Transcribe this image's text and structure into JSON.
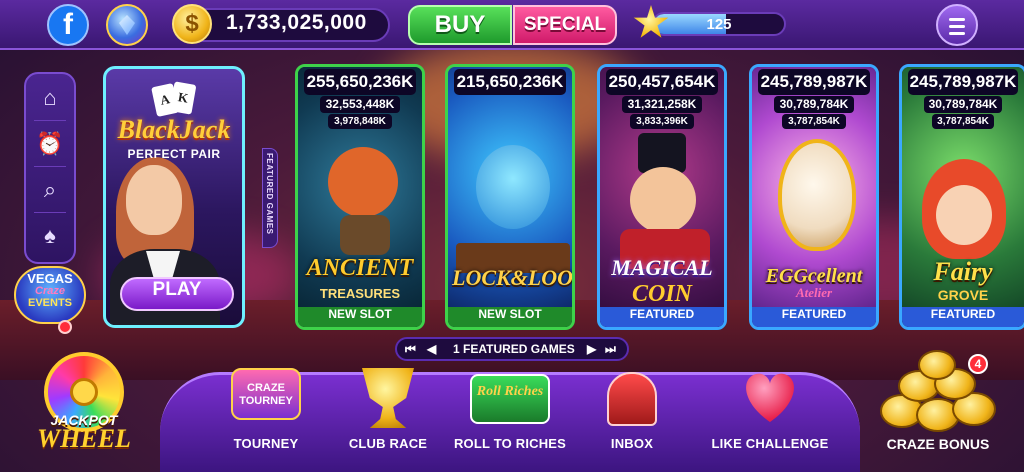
{
  "topbar": {
    "coins": "1,733,025,000",
    "buy_label": "BUY",
    "special_label": "SPECIAL",
    "level_progress_value": "125",
    "level_progress_fraction": 0.55,
    "facebook_glyph": "f",
    "coin_glyph": "$"
  },
  "left_rail": {
    "items": [
      {
        "icon": "home-icon",
        "glyph": "⌂"
      },
      {
        "icon": "alarm-clock-icon",
        "glyph": "⏰"
      },
      {
        "icon": "search-icon",
        "glyph": "⌕"
      },
      {
        "icon": "cards-icon",
        "glyph": "♠"
      }
    ],
    "events": {
      "line1": "VEGAS",
      "line2": "Craze",
      "line3": "EVENTS"
    }
  },
  "blackjack": {
    "title": "BlackJack",
    "subtitle": "PERFECT PAIR",
    "play_label": "PLAY",
    "card1": "A",
    "card2": "K"
  },
  "featured_tab": "FEATURED GAMES",
  "slots": [
    {
      "jackpot_major": "255,650,236K",
      "jackpot_minor": "32,553,448K",
      "jackpot_mini": "3,978,848K",
      "logo": "ANCIENT",
      "logo_sub": "TREASURES",
      "tag": "NEW SLOT",
      "tag_color": "#1f8a2a"
    },
    {
      "jackpot_major": "215,650,236K",
      "jackpot_minor": "",
      "jackpot_mini": "",
      "logo": "LOCK&LOOT",
      "logo_sub": "",
      "tag": "NEW SLOT",
      "tag_color": "#1f8a2a"
    },
    {
      "jackpot_major": "250,457,654K",
      "jackpot_minor": "31,321,258K",
      "jackpot_mini": "3,833,396K",
      "logo": "MAGICAL",
      "logo_sub": "COIN",
      "tag": "FEATURED",
      "tag_color": "#2a5ad8"
    },
    {
      "jackpot_major": "245,789,987K",
      "jackpot_minor": "30,789,784K",
      "jackpot_mini": "3,787,854K",
      "logo": "EGGcellent",
      "logo_sub": "Atelier",
      "tag": "FEATURED",
      "tag_color": "#2a5ad8"
    },
    {
      "jackpot_major": "245,789,987K",
      "jackpot_minor": "30,789,784K",
      "jackpot_mini": "3,787,854K",
      "logo": "Fairy",
      "logo_sub": "GROVE",
      "tag": "FEATURED",
      "tag_color": "#2a5ad8"
    }
  ],
  "pager": {
    "label": "1 FEATURED GAMES",
    "first": "⏮",
    "prev": "◀",
    "next": "▶",
    "last": "⏭"
  },
  "bottom_nav": {
    "jackpot_wheel": {
      "line1": "JACKPOT",
      "line2": "WHEEL"
    },
    "items": [
      {
        "label": "TOURNEY",
        "icon_text": "CRAZE TOURNEY"
      },
      {
        "label": "CLUB RACE",
        "icon_text": ""
      },
      {
        "label": "ROLL TO RICHES",
        "icon_text": "Roll Riches"
      },
      {
        "label": "INBOX",
        "icon_text": ""
      },
      {
        "label": "LIKE CHALLENGE",
        "icon_text": ""
      }
    ],
    "craze_bonus": {
      "label": "CRAZE BONUS",
      "badge": "4"
    }
  }
}
